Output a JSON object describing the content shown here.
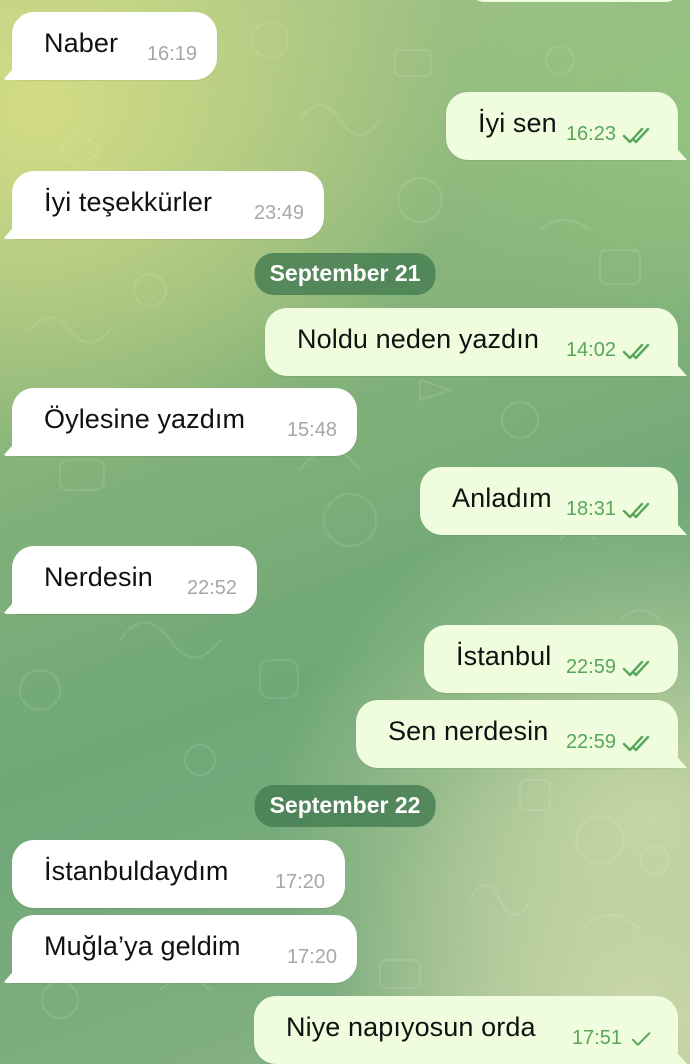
{
  "colors": {
    "incoming_bubble": "#ffffff",
    "outgoing_bubble": "#effdde",
    "outgoing_time": "#59a65a",
    "incoming_time": "#a4a7ab",
    "date_pill": "#467d52"
  },
  "icons": {
    "read": "double-check-icon",
    "sent": "single-check-icon"
  },
  "messages": [
    {
      "direction": "incoming",
      "text": "Naber",
      "time": "16:19",
      "status": null
    },
    {
      "direction": "outgoing",
      "text": "İyi sen",
      "time": "16:23",
      "status": "read"
    },
    {
      "direction": "incoming",
      "text": "İyi teşekkürler",
      "time": "23:49",
      "status": null
    },
    {
      "type": "date_separator",
      "label": "September 21"
    },
    {
      "direction": "outgoing",
      "text": "Noldu neden yazdın",
      "time": "14:02",
      "status": "read"
    },
    {
      "direction": "incoming",
      "text": "Öylesine yazdım",
      "time": "15:48",
      "status": null
    },
    {
      "direction": "outgoing",
      "text": "Anladım",
      "time": "18:31",
      "status": "read"
    },
    {
      "direction": "incoming",
      "text": "Nerdesin",
      "time": "22:52",
      "status": null
    },
    {
      "direction": "outgoing",
      "text": "İstanbul",
      "time": "22:59",
      "status": "read"
    },
    {
      "direction": "outgoing",
      "text": "Sen nerdesin",
      "time": "22:59",
      "status": "read"
    },
    {
      "type": "date_separator",
      "label": "September 22"
    },
    {
      "direction": "incoming",
      "text": "İstanbuldaydım",
      "time": "17:20",
      "status": null
    },
    {
      "direction": "incoming",
      "text": "Muğla’ya geldim",
      "time": "17:20",
      "status": null
    },
    {
      "direction": "outgoing",
      "text": "Niye napıyosun orda",
      "time": "17:51",
      "status": "sent"
    }
  ]
}
